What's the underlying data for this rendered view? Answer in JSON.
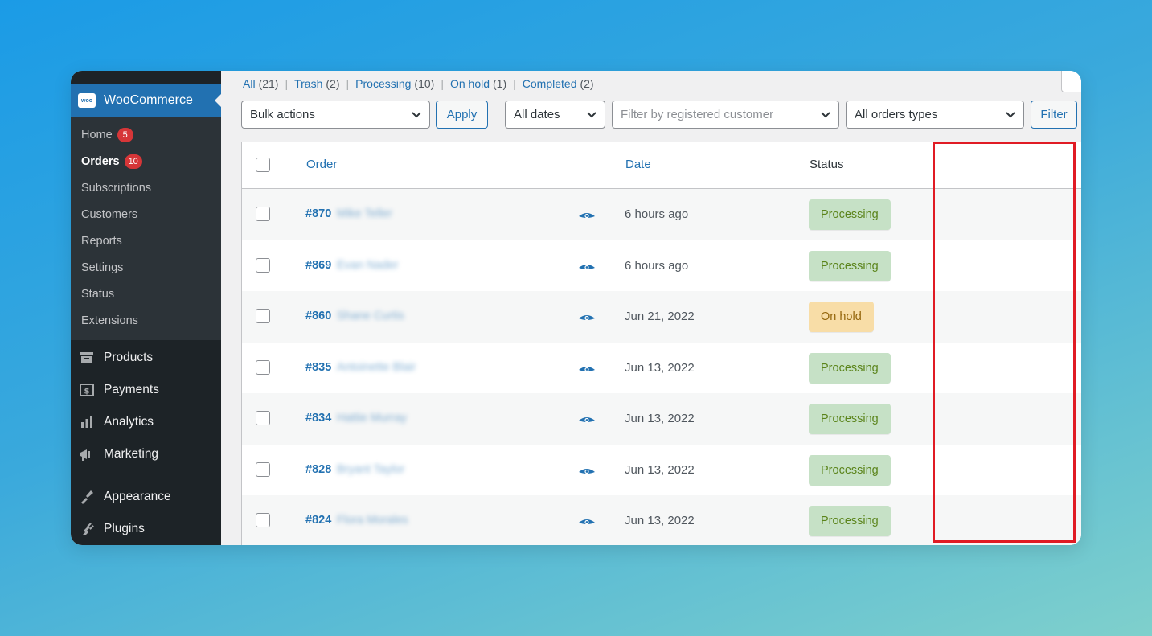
{
  "sidebar": {
    "title": "WooCommerce",
    "logo_text": "woo",
    "submenu": [
      {
        "label": "Home",
        "badge": "5",
        "current": false
      },
      {
        "label": "Orders",
        "badge": "10",
        "current": true
      },
      {
        "label": "Subscriptions",
        "badge": null,
        "current": false
      },
      {
        "label": "Customers",
        "badge": null,
        "current": false
      },
      {
        "label": "Reports",
        "badge": null,
        "current": false
      },
      {
        "label": "Settings",
        "badge": null,
        "current": false
      },
      {
        "label": "Status",
        "badge": null,
        "current": false
      },
      {
        "label": "Extensions",
        "badge": null,
        "current": false
      }
    ],
    "menu": [
      {
        "label": "Products",
        "icon": "products-icon"
      },
      {
        "label": "Payments",
        "icon": "payments-icon"
      },
      {
        "label": "Analytics",
        "icon": "analytics-icon"
      },
      {
        "label": "Marketing",
        "icon": "marketing-icon"
      },
      {
        "label": "Appearance",
        "icon": "appearance-icon"
      },
      {
        "label": "Plugins",
        "icon": "plugins-icon"
      }
    ]
  },
  "views": [
    {
      "label": "All",
      "count": "(21)"
    },
    {
      "label": "Trash",
      "count": "(2)"
    },
    {
      "label": "Processing",
      "count": "(10)"
    },
    {
      "label": "On hold",
      "count": "(1)"
    },
    {
      "label": "Completed",
      "count": "(2)"
    }
  ],
  "filters": {
    "bulk_actions": "Bulk actions",
    "apply": "Apply",
    "dates": "All dates",
    "customer_placeholder": "Filter by registered customer",
    "order_types": "All orders types",
    "filter": "Filter"
  },
  "table": {
    "headers": {
      "order": "Order",
      "date": "Date",
      "status": "Status"
    },
    "rows": [
      {
        "order": "#870",
        "customer": "Mike Teller",
        "date": "6 hours ago",
        "status": "Processing"
      },
      {
        "order": "#869",
        "customer": "Evan Nader",
        "date": "6 hours ago",
        "status": "Processing"
      },
      {
        "order": "#860",
        "customer": "Shane Curtis",
        "date": "Jun 21, 2022",
        "status": "On hold"
      },
      {
        "order": "#835",
        "customer": "Antoinette Blair",
        "date": "Jun 13, 2022",
        "status": "Processing"
      },
      {
        "order": "#834",
        "customer": "Hattie Murray",
        "date": "Jun 13, 2022",
        "status": "Processing"
      },
      {
        "order": "#828",
        "customer": "Bryant Taylor",
        "date": "Jun 13, 2022",
        "status": "Processing"
      },
      {
        "order": "#824",
        "customer": "Flora Morales",
        "date": "Jun 13, 2022",
        "status": "Processing"
      }
    ]
  },
  "colors": {
    "accent": "#2271b1",
    "sidebar_bg": "#1d2327",
    "processing_bg": "#c6e1c6",
    "onhold_bg": "#f8dda7",
    "highlight": "#e01b24"
  }
}
